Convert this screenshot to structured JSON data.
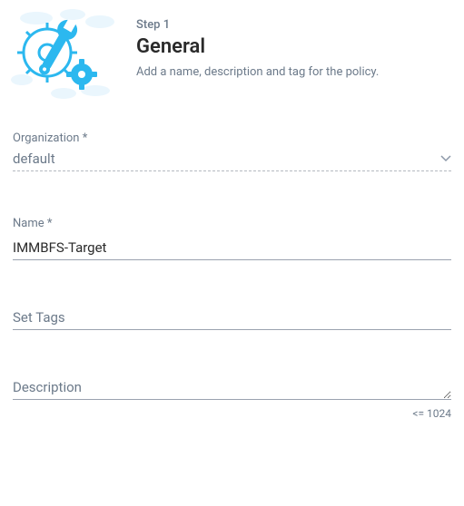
{
  "header": {
    "step": "Step 1",
    "title": "General",
    "subtitle": "Add a name, description and tag for the policy."
  },
  "organization": {
    "label": "Organization *",
    "value": "default"
  },
  "name": {
    "label": "Name *",
    "value": "IMMBFS-Target"
  },
  "tags": {
    "placeholder": "Set Tags",
    "value": ""
  },
  "description": {
    "placeholder": "Description",
    "value": "",
    "hint": "<= 1024"
  },
  "colors": {
    "accent": "#2cb8ef",
    "accent_light": "#d9f2fc",
    "text_muted": "#6c7a8a"
  }
}
